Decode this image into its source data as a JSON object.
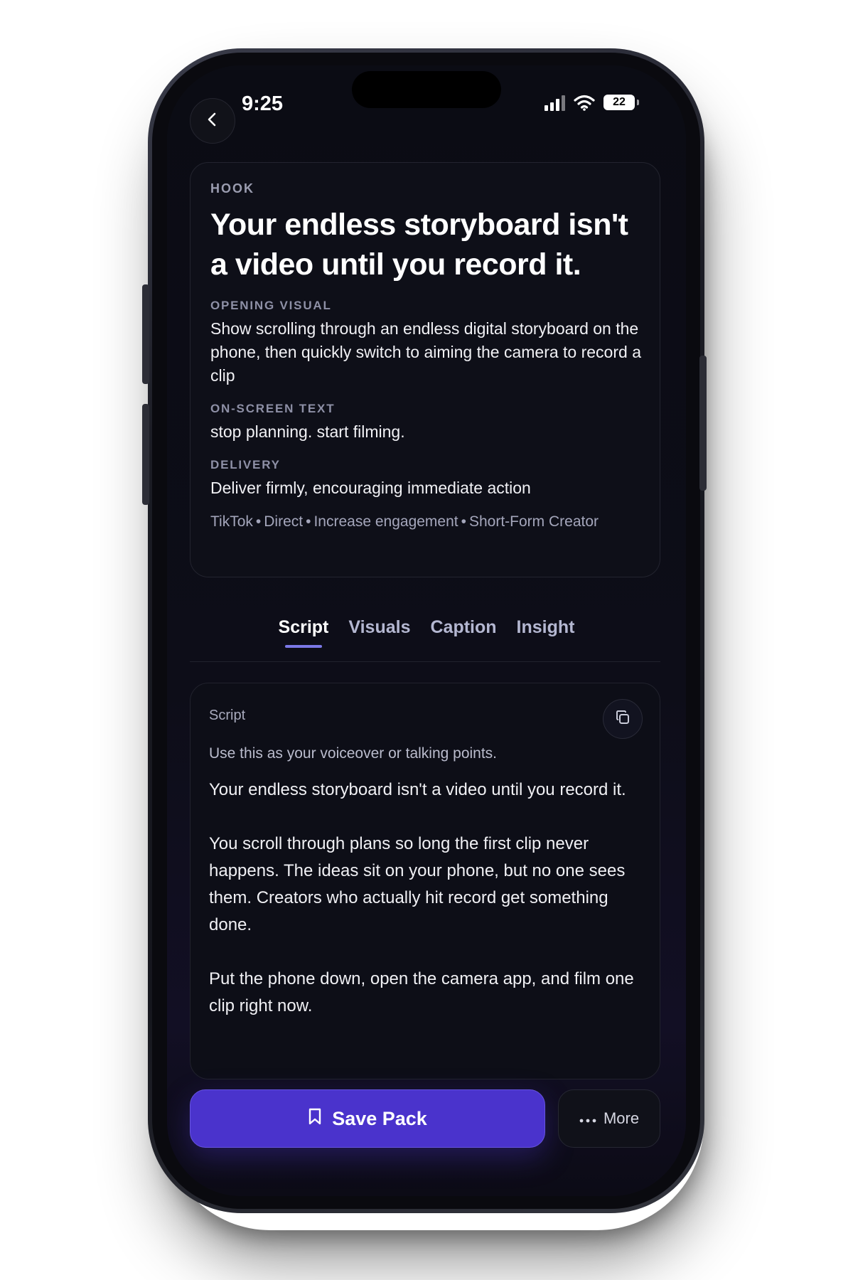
{
  "status_bar": {
    "time": "9:25",
    "battery": "22"
  },
  "hook": {
    "label": "HOOK",
    "title": "Your endless storyboard isn't a video until you record it.",
    "opening_visual_label": "OPENING VISUAL",
    "opening_visual_text": "Show scrolling through an endless digital storyboard on the phone, then quickly switch to aiming the camera to record a clip",
    "on_screen_text_label": "ON-SCREEN TEXT",
    "on_screen_text": "stop planning. start filming.",
    "delivery_label": "DELIVERY",
    "delivery_text": "Deliver firmly, encouraging immediate action",
    "tags": [
      "TikTok",
      "Direct",
      "Increase engagement",
      "Short-Form Creator"
    ]
  },
  "tabs": [
    {
      "label": "Script",
      "active": true
    },
    {
      "label": "Visuals",
      "active": false
    },
    {
      "label": "Caption",
      "active": false
    },
    {
      "label": "Insight",
      "active": false
    }
  ],
  "script": {
    "label": "Script",
    "subtitle": "Use this as your voiceover or talking points.",
    "paragraphs": [
      "Your endless storyboard isn't a video until you record it.",
      "You scroll through plans so long the first clip never happens. The ideas sit on your phone, but no one sees them. Creators who actually hit record get something done.",
      "Put the phone down, open the camera app, and film one clip right now."
    ]
  },
  "actions": {
    "save_label": "Save Pack",
    "more_label": "More"
  },
  "colors": {
    "accent": "#4a33cc",
    "tab_indicator": "#7b78e6",
    "background": "#0b0c14"
  },
  "icons": {
    "back": "chevron-left-icon",
    "copy": "copy-icon",
    "save": "bookmark-icon",
    "more": "ellipsis-icon",
    "signal": "signal-icon",
    "wifi": "wifi-icon",
    "battery": "battery-icon"
  }
}
